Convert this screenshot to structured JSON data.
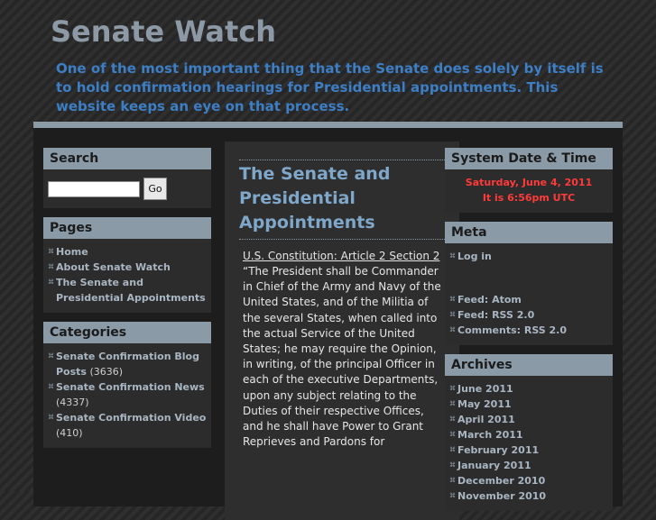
{
  "site": {
    "title": "Senate Watch",
    "description": "One of the most important thing that the Senate does solely by itself is to hold confirmation hearings for Presidential appointments. This website keeps an eye on that process."
  },
  "search": {
    "title": "Search",
    "placeholder": "",
    "button": "Go"
  },
  "pages": {
    "title": "Pages",
    "items": [
      {
        "label": "Home"
      },
      {
        "label": "About Senate Watch"
      },
      {
        "label": "The Senate and Presidential Appointments"
      }
    ]
  },
  "categories": {
    "title": "Categories",
    "items": [
      {
        "label": "Senate Confirmation Blog Posts",
        "count": "(3636)"
      },
      {
        "label": "Senate Confirmation News",
        "count": "(4337)"
      },
      {
        "label": "Senate Confirmation Video",
        "count": "(410)"
      }
    ]
  },
  "post": {
    "title": "The Senate and Presidential Appointments",
    "link": "U.S. Constitution: Article 2 Section 2",
    "text": "“The President shall be Commander in Chief of the Army and Navy of the United States, and of the Militia of the several States, when called into the actual Service of the United States; he may require the Opinion, in writing, of the principal Officer in each of the executive Departments, upon any subject relating to the Duties of their respective Offices, and he shall have Power to Grant Reprieves and Pardons for"
  },
  "system": {
    "title": "System Date & Time",
    "date": "Saturday, June 4, 2011",
    "time": "It is 6:56pm UTC"
  },
  "meta": {
    "title": "Meta",
    "login": "Log in",
    "feeds": [
      {
        "label": "Feed: Atom"
      },
      {
        "label": "Feed: RSS 2.0"
      },
      {
        "label": "Comments: RSS 2.0"
      }
    ]
  },
  "archives": {
    "title": "Archives",
    "items": [
      {
        "label": "June 2011"
      },
      {
        "label": "May 2011"
      },
      {
        "label": "April 2011"
      },
      {
        "label": "March 2011"
      },
      {
        "label": "February 2011"
      },
      {
        "label": "January 2011"
      },
      {
        "label": "December 2010"
      },
      {
        "label": "November 2010"
      }
    ]
  }
}
